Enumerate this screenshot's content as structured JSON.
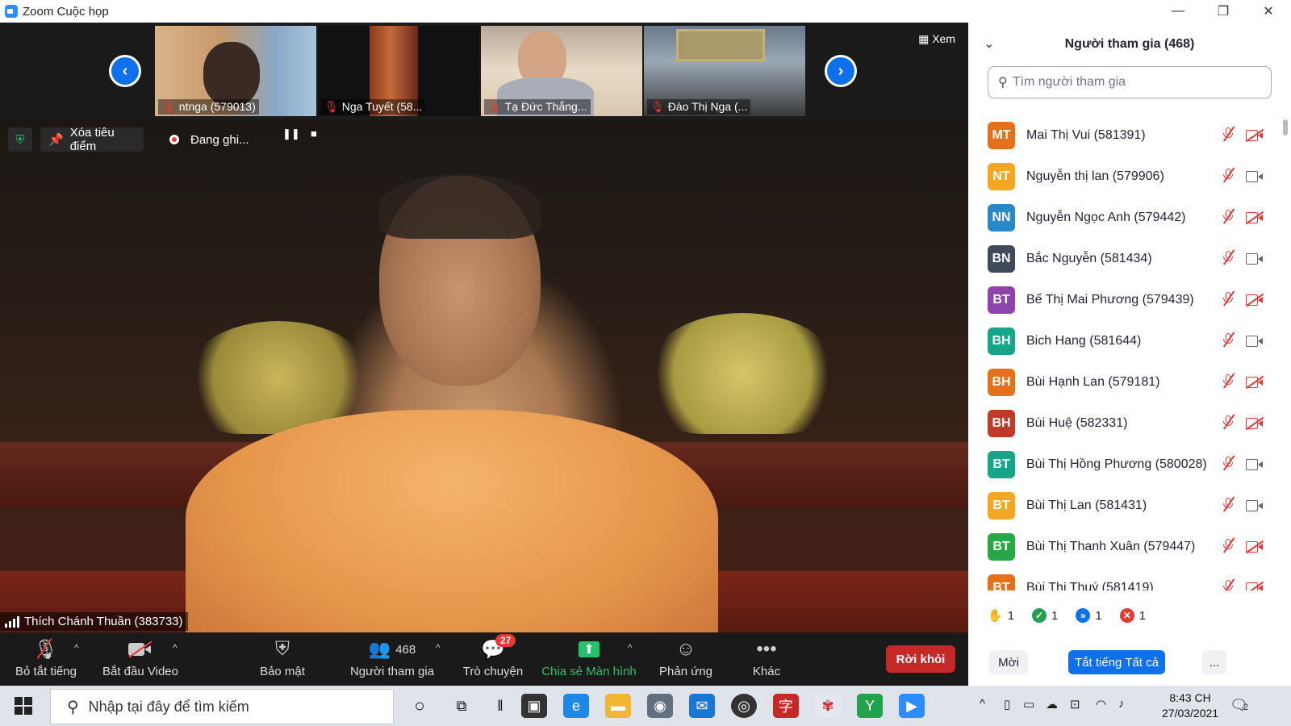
{
  "window": {
    "title": "Zoom Cuộc họp"
  },
  "strip": {
    "view_label": "Xem",
    "thumbs": [
      {
        "name": "ntnga (579013)"
      },
      {
        "name": "Nga Tuyết (58..."
      },
      {
        "name": "Tạ Đức Thắng..."
      },
      {
        "name": "Đào Thị Nga (..."
      }
    ]
  },
  "video": {
    "spotlight_label": "Xóa tiêu điểm",
    "recording_label": "Đang ghi...",
    "speaker_name": "Thích Chánh Thuần (383733)"
  },
  "toolbar": {
    "mute_label": "Bỏ tắt tiếng",
    "video_label": "Bắt đầu Video",
    "security_label": "Bảo mật",
    "participants_label": "Người tham gia",
    "participants_count": "468",
    "chat_label": "Trò chuyện",
    "chat_badge": "27",
    "share_label": "Chia sẻ Màn hình",
    "reactions_label": "Phản ứng",
    "more_label": "Khác",
    "leave_label": "Rời khỏi"
  },
  "panel": {
    "title": "Người tham gia (468)",
    "search_placeholder": "Tìm người tham gia",
    "participants": [
      {
        "initials": "MT",
        "name": "Mai Thị Vui (581391)",
        "color": "#e5711a",
        "video_off": true
      },
      {
        "initials": "NT",
        "name": "Nguyễn thị lan (579906)",
        "color": "#f5a623",
        "video_off": false
      },
      {
        "initials": "NN",
        "name": " Nguyễn Ngọc Anh  (579442)",
        "color": "#2a87c8",
        "video_off": true
      },
      {
        "initials": "BN",
        "name": "Bắc Nguyễn (581434)",
        "color": "#3f4a5a",
        "video_off": false
      },
      {
        "initials": "BT",
        "name": "Bế Thị Mai Phương (579439)",
        "color": "#8e44ad",
        "video_off": true
      },
      {
        "initials": "BH",
        "name": "Bich Hang (581644)",
        "color": "#17a589",
        "video_off": false
      },
      {
        "initials": "BH",
        "name": "Bùi Hạnh Lan (579181)",
        "color": "#e5711a",
        "video_off": true
      },
      {
        "initials": "BH",
        "name": "Bùi Huệ (582331)",
        "color": "#c0392b",
        "video_off": true
      },
      {
        "initials": "BT",
        "name": "Bùi Thị Hồng Phương (580028)",
        "color": "#17a589",
        "video_off": false
      },
      {
        "initials": "BT",
        "name": "Bùi Thị Lan (581431)",
        "color": "#f5a623",
        "video_off": false
      },
      {
        "initials": "BT",
        "name": "Bùi Thị Thanh Xuân (579447)",
        "color": "#27a844",
        "video_off": true
      },
      {
        "initials": "BT",
        "name": "Bùi Thị Thuý (581419)",
        "color": "#e5711a",
        "video_off": true
      }
    ],
    "reactions": {
      "raise_hand": "1",
      "yes": "1",
      "faster": "1",
      "no": "1"
    },
    "invite_label": "Mời",
    "mute_all_label": "Tắt tiếng Tất cả",
    "more_label": "..."
  },
  "taskbar": {
    "search_placeholder": "Nhập tại đây để tìm kiếm",
    "time": "8:43 CH",
    "date": "27/03/2021",
    "notifications": "2"
  }
}
